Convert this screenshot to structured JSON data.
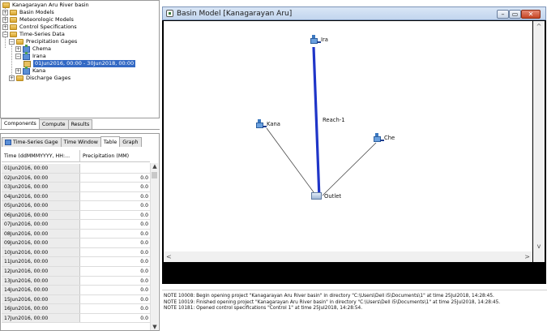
{
  "tree": {
    "items": [
      {
        "label": "Kanagarayan Aru River basin",
        "expand": ""
      },
      {
        "label": "Basin Models",
        "expand": "+"
      },
      {
        "label": "Meteorologic Models",
        "expand": "+"
      },
      {
        "label": "Control Specifications",
        "expand": "+"
      },
      {
        "label": "Time-Series Data",
        "expand": "−"
      },
      {
        "label": "Precipitation Gages",
        "expand": "−"
      },
      {
        "label": "Chema",
        "expand": "+"
      },
      {
        "label": "Irana",
        "expand": "−"
      },
      {
        "label": "01Jun2016, 00:00 - 30Jun2018, 00:00",
        "expand": ""
      },
      {
        "label": "Kana",
        "expand": "+"
      },
      {
        "label": "Discharge Gages",
        "expand": "+"
      }
    ]
  },
  "component_tabs": [
    "Components",
    "Compute",
    "Results"
  ],
  "table_panel": {
    "tabs": [
      "Time-Series Gage",
      "Time Window",
      "Table",
      "Graph"
    ],
    "headers": [
      "Time (ddMMMYYYY, HH:...",
      "Precipitation (MM)"
    ],
    "rows": [
      {
        "time": "01Jun2016, 00:00",
        "value": ""
      },
      {
        "time": "02Jun2016, 00:00",
        "value": "0.0"
      },
      {
        "time": "03Jun2016, 00:00",
        "value": "0.0"
      },
      {
        "time": "04Jun2016, 00:00",
        "value": "0.0"
      },
      {
        "time": "05Jun2016, 00:00",
        "value": "0.0"
      },
      {
        "time": "06Jun2016, 00:00",
        "value": "0.0"
      },
      {
        "time": "07Jun2016, 00:00",
        "value": "0.0"
      },
      {
        "time": "08Jun2016, 00:00",
        "value": "0.0"
      },
      {
        "time": "09Jun2016, 00:00",
        "value": "0.0"
      },
      {
        "time": "10Jun2016, 00:00",
        "value": "0.0"
      },
      {
        "time": "11Jun2016, 00:00",
        "value": "0.0"
      },
      {
        "time": "12Jun2016, 00:00",
        "value": "0.0"
      },
      {
        "time": "13Jun2016, 00:00",
        "value": "0.0"
      },
      {
        "time": "14Jun2016, 00:00",
        "value": "0.0"
      },
      {
        "time": "15Jun2016, 00:00",
        "value": "0.0"
      },
      {
        "time": "16Jun2016, 00:00",
        "value": "0.0"
      },
      {
        "time": "17Jun2016, 00:00",
        "value": "0.0"
      }
    ]
  },
  "basin_window": {
    "title": "Basin Model [Kanagarayan Aru]",
    "elements": {
      "ira": "Ira",
      "kana": "Kana",
      "che": "Che",
      "outlet": "Outlet",
      "reach": "Reach-1"
    },
    "colors": {
      "reach": "#1f35c8",
      "connector": "#444444"
    }
  },
  "messages": [
    "NOTE 10008:  Begin opening project \"Kanagarayan Aru River basin\" in directory \"C:\\Users\\Dell i5\\Documents\\1\" at time 25Jul2018, 14:28:45.",
    "NOTE 10019:  Finished opening project \"Kanagarayan Aru River basin\" in directory \"C:\\Users\\Dell i5\\Documents\\1\" at time 25Jul2018, 14:28:45.",
    "NOTE 10181:  Opened control specifications \"Control 1\" at time 25Jul2018, 14:28:54."
  ]
}
